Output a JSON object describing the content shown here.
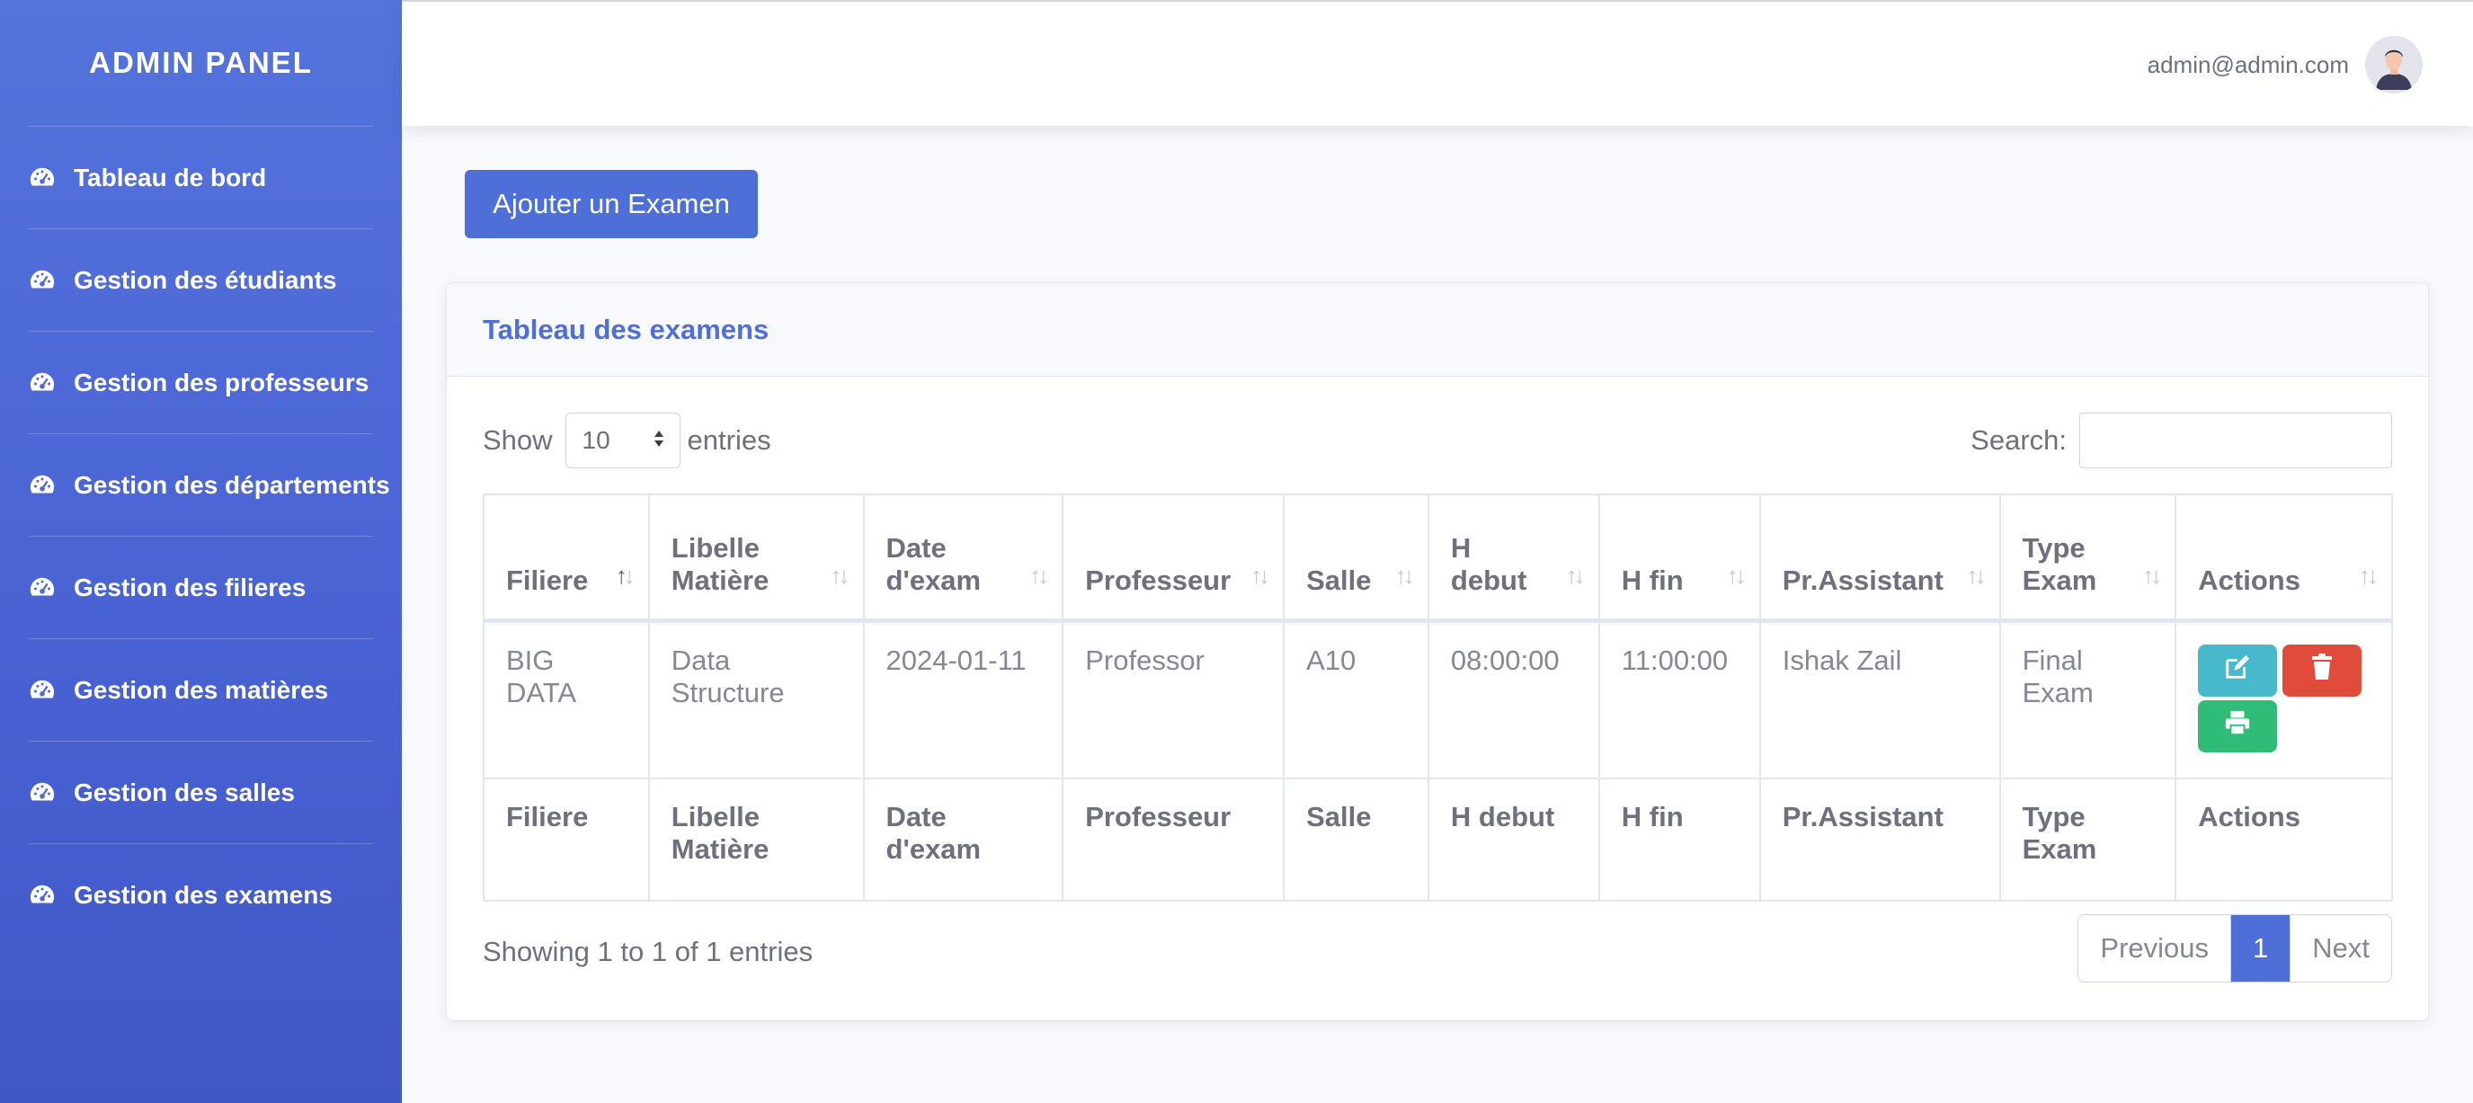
{
  "sidebar": {
    "brand": "ADMIN PANEL",
    "items": [
      {
        "label": "Tableau de bord",
        "icon": "tachometer-icon"
      },
      {
        "label": "Gestion des étudiants",
        "icon": "tachometer-icon"
      },
      {
        "label": "Gestion des professeurs",
        "icon": "tachometer-icon"
      },
      {
        "label": "Gestion des départements",
        "icon": "tachometer-icon"
      },
      {
        "label": "Gestion des filieres",
        "icon": "tachometer-icon"
      },
      {
        "label": "Gestion des matières",
        "icon": "tachometer-icon"
      },
      {
        "label": "Gestion des salles",
        "icon": "tachometer-icon"
      },
      {
        "label": "Gestion des examens",
        "icon": "tachometer-icon"
      }
    ]
  },
  "topbar": {
    "user_email": "admin@admin.com"
  },
  "main": {
    "add_button": "Ajouter un Examen",
    "card_title": "Tableau des examens",
    "length": {
      "show": "Show",
      "value": "10",
      "entries": "entries"
    },
    "search": {
      "label": "Search:",
      "value": ""
    },
    "table": {
      "columns": [
        {
          "line1": "Filiere",
          "line2": ""
        },
        {
          "line1": "Libelle",
          "line2": "Matière"
        },
        {
          "line1": "Date",
          "line2": "d'exam"
        },
        {
          "line1": "Professeur",
          "line2": ""
        },
        {
          "line1": "Salle",
          "line2": ""
        },
        {
          "line1": "H",
          "line2": "debut"
        },
        {
          "line1": "H fin",
          "line2": ""
        },
        {
          "line1": "Pr.Assistant",
          "line2": ""
        },
        {
          "line1": "Type",
          "line2": "Exam"
        },
        {
          "line1": "Actions",
          "line2": ""
        }
      ],
      "footer": [
        "Filiere",
        "Libelle Matière",
        "Date d'exam",
        "Professeur",
        "Salle",
        "H debut",
        "H fin",
        "Pr.Assistant",
        "Type Exam",
        "Actions"
      ],
      "rows": [
        {
          "filiere": "BIG DATA",
          "matiere": "Data Structure",
          "date": "2024-01-11",
          "professeur": "Professor",
          "salle": "A10",
          "h_debut": "08:00:00",
          "h_fin": "11:00:00",
          "assistant": "Ishak Zail",
          "type": "Final Exam"
        }
      ]
    },
    "info": "Showing 1 to 1 of 1 entries",
    "pagination": {
      "previous": "Previous",
      "current": "1",
      "next": "Next"
    }
  }
}
